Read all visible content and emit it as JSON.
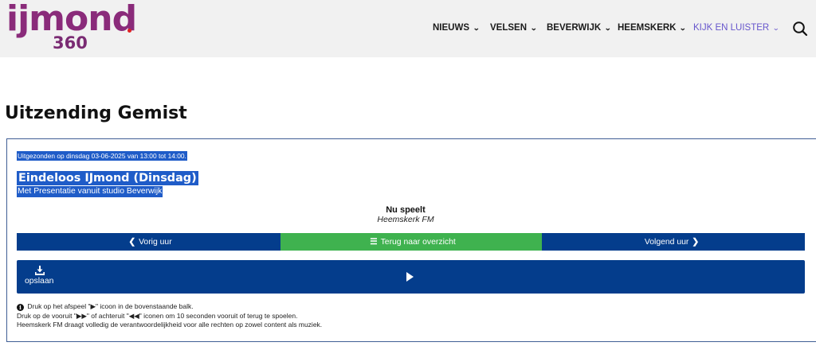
{
  "header": {
    "logo": {
      "name": "ijmond",
      "sub": "360"
    },
    "nav": [
      {
        "label": "NIEUWS",
        "icon": "chevron-down-icon"
      },
      {
        "label": "VELSEN",
        "icon": "chevron-down-icon"
      },
      {
        "label": "BEVERWIJK",
        "icon": "chevron-down-icon"
      },
      {
        "label": "HEEMSKERK",
        "icon": "chevron-down-icon"
      },
      {
        "label": "KIJK EN LUISTER",
        "icon": "chevron-down-icon",
        "active": true
      }
    ],
    "search_icon": "search-icon"
  },
  "page": {
    "title": "Uitzending Gemist"
  },
  "broadcast": {
    "aired": "Uitgezonden op dinsdag 03-06-2025 van 13:00 tot 14:00.",
    "title": "Eindeloos IJmond (Dinsdag)",
    "subtitle": "Met Presentatie vanuit studio Beverwijk",
    "now_playing_label": "Nu speelt",
    "now_playing_station": "Heemskerk FM"
  },
  "navigation_buttons": {
    "prev": "Vorig uur",
    "back": "Terug naar overzicht",
    "next": "Volgend uur"
  },
  "player": {
    "save_label": "opslaan",
    "save_icon": "download-icon",
    "play_icon": "play-icon"
  },
  "info": {
    "line1_pre": "Druk op het afspeel \"",
    "line1_post": "\" icoon in de bovenstaande balk.",
    "line2": "Druk op de vooruit \"▶▶\" of achteruit \"◀◀\" iconen om 10 seconden vooruit of terug te spoelen.",
    "line3": "Heemskerk FM draagt volledig de verantwoordelijkheid voor alle rechten op zowel content als muziek."
  },
  "colors": {
    "brand": "#8a2b7a",
    "primary_button": "#043d8c",
    "back_button": "#3fb24f",
    "active_nav": "#6655cc",
    "highlight": "#1f5cc8"
  }
}
